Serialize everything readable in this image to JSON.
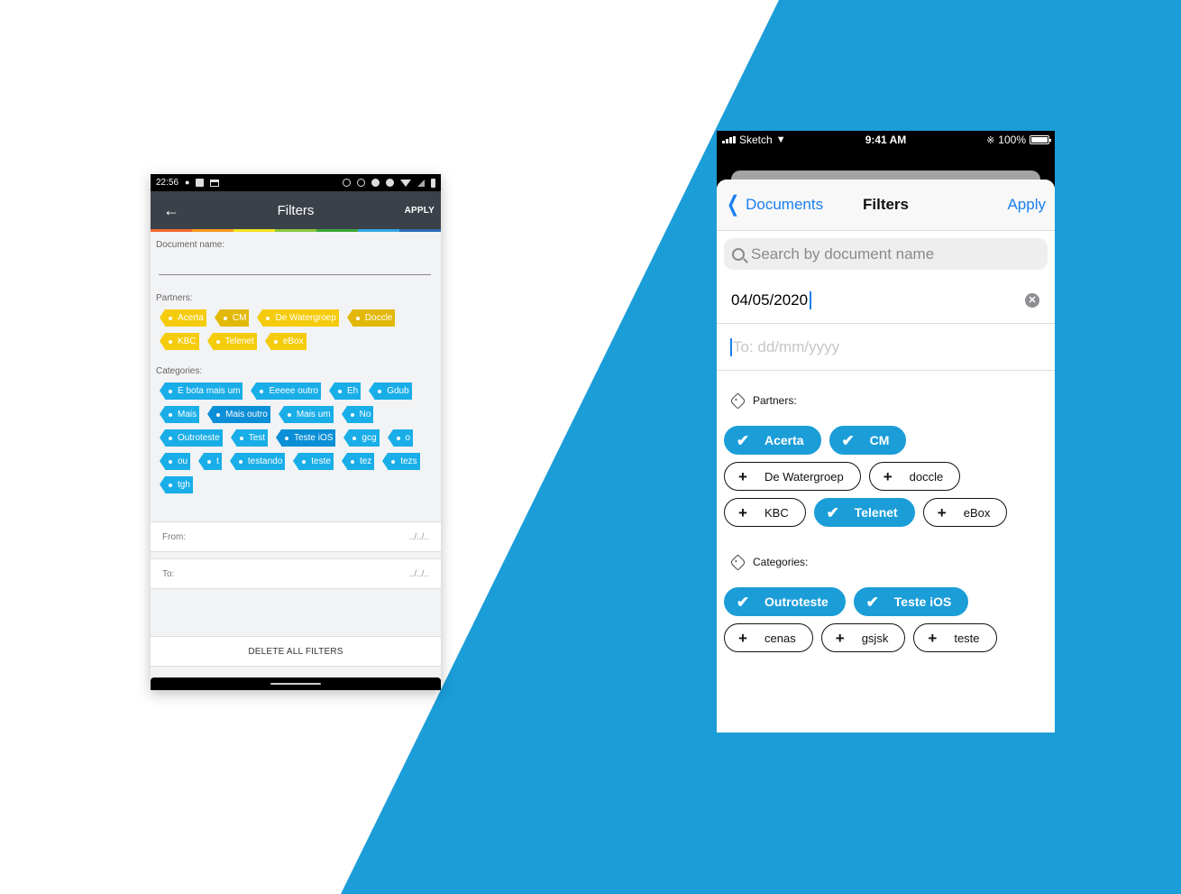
{
  "android": {
    "status_bar": {
      "time": "22:56"
    },
    "toolbar": {
      "title": "Filters",
      "apply_label": "APPLY",
      "back_icon": "arrow-left"
    },
    "rainbow_colors": [
      "#f26a2e",
      "#f89a1c",
      "#f5e21b",
      "#8cc63f",
      "#3aa635",
      "#34a7e0",
      "#2a6cb5"
    ],
    "document_name": {
      "label": "Document name:",
      "value": ""
    },
    "partners": {
      "label": "Partners:",
      "tags": [
        {
          "label": "Acerta",
          "selected": false
        },
        {
          "label": "CM",
          "selected": true
        },
        {
          "label": "De Watergroep",
          "selected": false
        },
        {
          "label": "Doccle",
          "selected": true
        },
        {
          "label": "KBC",
          "selected": false
        },
        {
          "label": "Telenet",
          "selected": false
        },
        {
          "label": "eBox",
          "selected": false
        }
      ]
    },
    "categories": {
      "label": "Categories:",
      "tags": [
        {
          "label": "E bota mais um",
          "selected": false
        },
        {
          "label": "Eeeee outro",
          "selected": false
        },
        {
          "label": "Eh",
          "selected": false
        },
        {
          "label": "Gdub",
          "selected": false
        },
        {
          "label": "Mais",
          "selected": false
        },
        {
          "label": "Mais outro",
          "selected": true
        },
        {
          "label": "Mais um",
          "selected": false
        },
        {
          "label": "No",
          "selected": false
        },
        {
          "label": "Outroteste",
          "selected": false
        },
        {
          "label": "Test",
          "selected": false
        },
        {
          "label": "Teste iOS",
          "selected": true
        },
        {
          "label": "gcg",
          "selected": false
        },
        {
          "label": "o",
          "selected": false
        },
        {
          "label": "ou",
          "selected": false
        },
        {
          "label": "t",
          "selected": false
        },
        {
          "label": "testando",
          "selected": false
        },
        {
          "label": "teste",
          "selected": false
        },
        {
          "label": "tez",
          "selected": false
        },
        {
          "label": "tezs",
          "selected": false
        },
        {
          "label": "tgh",
          "selected": false
        }
      ]
    },
    "from": {
      "label": "From:",
      "placeholder": "../../.."
    },
    "to": {
      "label": "To:",
      "placeholder": "../../.."
    },
    "delete_all_label": "DELETE ALL FILTERS"
  },
  "ios": {
    "status_bar": {
      "carrier": "Sketch",
      "time": "9:41 AM",
      "battery": "100%"
    },
    "nav": {
      "back_label": "Documents",
      "title": "Filters",
      "apply_label": "Apply"
    },
    "search": {
      "placeholder": "Search by document name"
    },
    "from_date": {
      "value": "04/05/2020"
    },
    "to_date": {
      "placeholder": "To: dd/mm/yyyy"
    },
    "partners": {
      "label": "Partners:",
      "chips": [
        {
          "label": "Acerta",
          "selected": true
        },
        {
          "label": "CM",
          "selected": true
        },
        {
          "label": "De Watergroep",
          "selected": false
        },
        {
          "label": "doccle",
          "selected": false
        },
        {
          "label": "KBC",
          "selected": false
        },
        {
          "label": "Telenet",
          "selected": true
        },
        {
          "label": "eBox",
          "selected": false
        }
      ]
    },
    "categories": {
      "label": "Categories:",
      "chips": [
        {
          "label": "Outroteste",
          "selected": true
        },
        {
          "label": "Teste iOS",
          "selected": true
        },
        {
          "label": "cenas",
          "selected": false
        },
        {
          "label": "gsjsk",
          "selected": false
        },
        {
          "label": "teste",
          "selected": false
        }
      ]
    }
  },
  "colors": {
    "brand_blue": "#1b9dd8",
    "ios_tint": "#1a7ff0",
    "android_toolbar": "#3b4149",
    "partner_yellow": "#f5cc0d",
    "category_blue": "#19aee8"
  }
}
